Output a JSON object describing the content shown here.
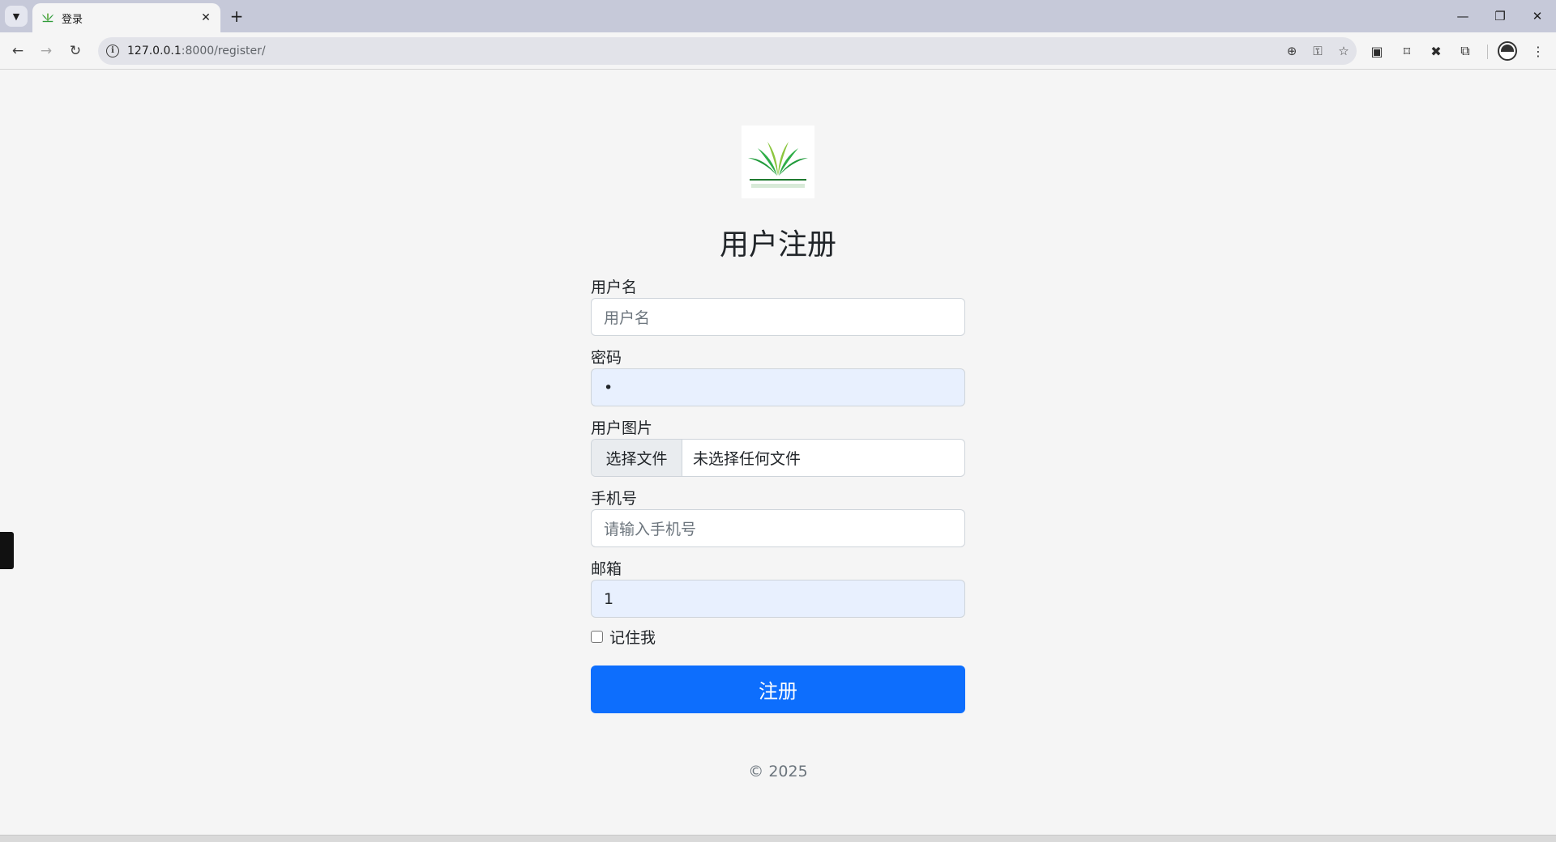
{
  "browser": {
    "tab_title": "登录",
    "url_host": "127.0.0.1",
    "url_path": ":8000/register/"
  },
  "form": {
    "title": "用户注册",
    "username": {
      "label": "用户名",
      "placeholder": "用户名",
      "value": ""
    },
    "password": {
      "label": "密码",
      "value": "•"
    },
    "avatar": {
      "label": "用户图片",
      "button_label": "选择文件",
      "status": "未选择任何文件"
    },
    "phone": {
      "label": "手机号",
      "placeholder": "请输入手机号",
      "value": ""
    },
    "email": {
      "label": "邮箱",
      "value": "1"
    },
    "remember": {
      "label": "记住我",
      "checked": false
    },
    "submit_label": "注册"
  },
  "footer": {
    "text": "© 2025"
  },
  "colors": {
    "primary": "#0d6efd",
    "autofill": "#e8f0fe",
    "page_bg": "#f5f5f5",
    "tabstrip_bg": "#c6c9d9"
  },
  "icons": {
    "tab_list": "chevron-down-icon",
    "favicon": "plant-logo-icon",
    "close": "close-icon",
    "new_tab": "plus-icon",
    "back": "arrow-left-icon",
    "forward": "arrow-right-icon",
    "reload": "reload-icon",
    "site_info": "info-icon",
    "zoom": "zoom-icon",
    "password_key": "key-icon",
    "bookmark_star": "star-icon",
    "extensions": "puzzle-icon",
    "menu": "kebab-menu-icon"
  }
}
